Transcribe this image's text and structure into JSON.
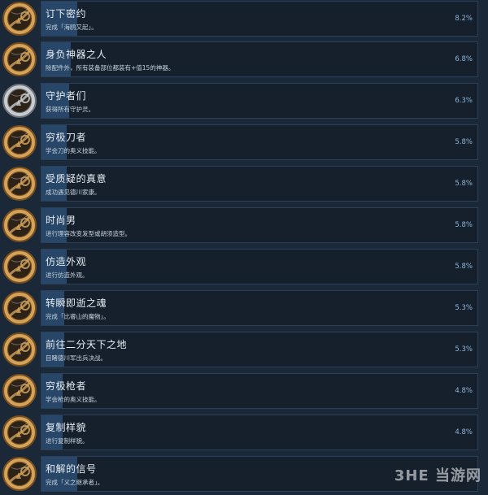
{
  "achievements": [
    {
      "title": "订下密约",
      "desc": "完成「海鸥又起」。",
      "percent_label": "8.2%",
      "percent": 8.2,
      "icon": "gold-medal-icon"
    },
    {
      "title": "身负神器之人",
      "desc": "除配件外，所有装备部位都装有+值15的神器。",
      "percent_label": "6.8%",
      "percent": 6.8,
      "icon": "gold-medal-icon"
    },
    {
      "title": "守护者们",
      "desc": "获得所有守护灵。",
      "percent_label": "6.3%",
      "percent": 6.3,
      "icon": "silver-medal-icon"
    },
    {
      "title": "穷极刀者",
      "desc": "学会刀的奥义技能。",
      "percent_label": "5.8%",
      "percent": 5.8,
      "icon": "gold-medal-icon"
    },
    {
      "title": "受质疑的真意",
      "desc": "成功遇见德川家康。",
      "percent_label": "5.8%",
      "percent": 5.8,
      "icon": "gold-medal-icon"
    },
    {
      "title": "时尚男",
      "desc": "进行理容改变发型或胡须造型。",
      "percent_label": "5.8%",
      "percent": 5.8,
      "icon": "gold-medal-icon"
    },
    {
      "title": "仿造外观",
      "desc": "进行仿造外观。",
      "percent_label": "5.8%",
      "percent": 5.8,
      "icon": "gold-medal-icon"
    },
    {
      "title": "转瞬即逝之魂",
      "desc": "完成「比睿山的魔物」。",
      "percent_label": "5.3%",
      "percent": 5.3,
      "icon": "gold-medal-icon"
    },
    {
      "title": "前往二分天下之地",
      "desc": "目睹德川军出兵决战。",
      "percent_label": "5.3%",
      "percent": 5.3,
      "icon": "gold-medal-icon"
    },
    {
      "title": "穷极枪者",
      "desc": "学会枪的奥义技能。",
      "percent_label": "4.8%",
      "percent": 4.8,
      "icon": "gold-medal-icon"
    },
    {
      "title": "复制样貌",
      "desc": "进行复制样貌。",
      "percent_label": "4.8%",
      "percent": 4.8,
      "icon": "gold-medal-icon"
    },
    {
      "title": "和解的信号",
      "desc": "完成「义之继承者」。",
      "percent_label": "",
      "percent": null,
      "icon": "gold-medal-icon"
    }
  ],
  "watermark": "3HE 当游网",
  "colors": {
    "background": "#1b2838",
    "bar_background": "#16202d",
    "bar_fill": "#2b4e73",
    "gold": "#d3a35a",
    "silver": "#c8ccd0"
  }
}
